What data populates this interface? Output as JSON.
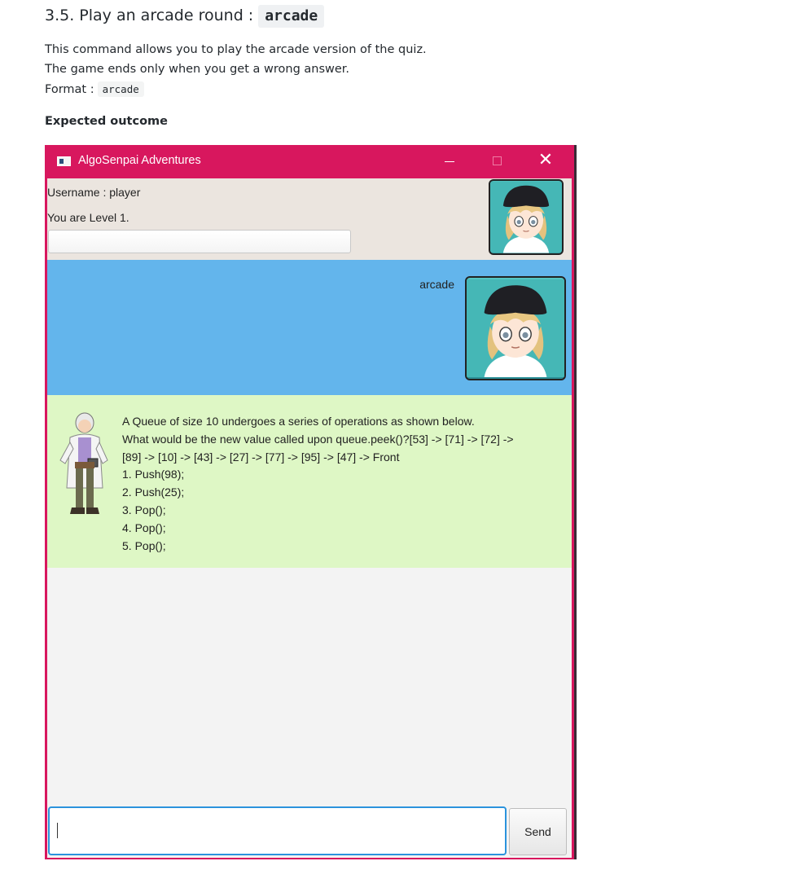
{
  "heading": {
    "text": "3.5. Play an arcade round :",
    "code": "arcade"
  },
  "description": {
    "line1": "This command allows you to play the arcade version of the quiz.",
    "line2": "The game ends only when you get a wrong answer.",
    "format_label": "Format :",
    "format_code": "arcade"
  },
  "expected_label": "Expected outcome",
  "window": {
    "title": "AlgoSenpai Adventures",
    "accent_color": "#d8175e",
    "username_line": "Username : player",
    "level_line": "You are Level 1.",
    "user_message": "arcade",
    "bot_message_lines": [
      "A Queue of size 10 undergoes a series of operations as shown below.",
      "What would be the new value called upon queue.peek()?[53] -> [71] -> [72] ->",
      "[89] -> [10] -> [43] -> [27] -> [77] -> [95] -> [47] -> Front",
      "1. Push(98);",
      "2. Push(25);",
      "3. Pop();",
      "4. Pop();",
      "5. Pop();"
    ],
    "send_label": "Send",
    "icons": {
      "app": "app-window-icon",
      "minimize": "minimize-icon",
      "maximize": "maximize-icon",
      "close": "close-icon"
    },
    "colors": {
      "user_area": "#63b5ec",
      "bot_area": "#def7c5",
      "top_panel": "#ebe5df"
    }
  }
}
